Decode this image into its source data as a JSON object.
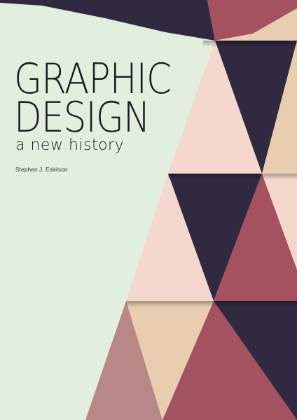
{
  "cover": {
    "title_line1": "GRAPHIC",
    "title_line2": "DESIGN",
    "subtitle": "a new history",
    "author": "Stephen J. Eskilson"
  },
  "colors": {
    "background": "#e2efdf",
    "navy": "#302940",
    "crimson": "#a55260",
    "pink": "#f4d8cd",
    "tan": "#e8cdb1",
    "mauve": "#b98788",
    "text": "#1c1a22"
  }
}
